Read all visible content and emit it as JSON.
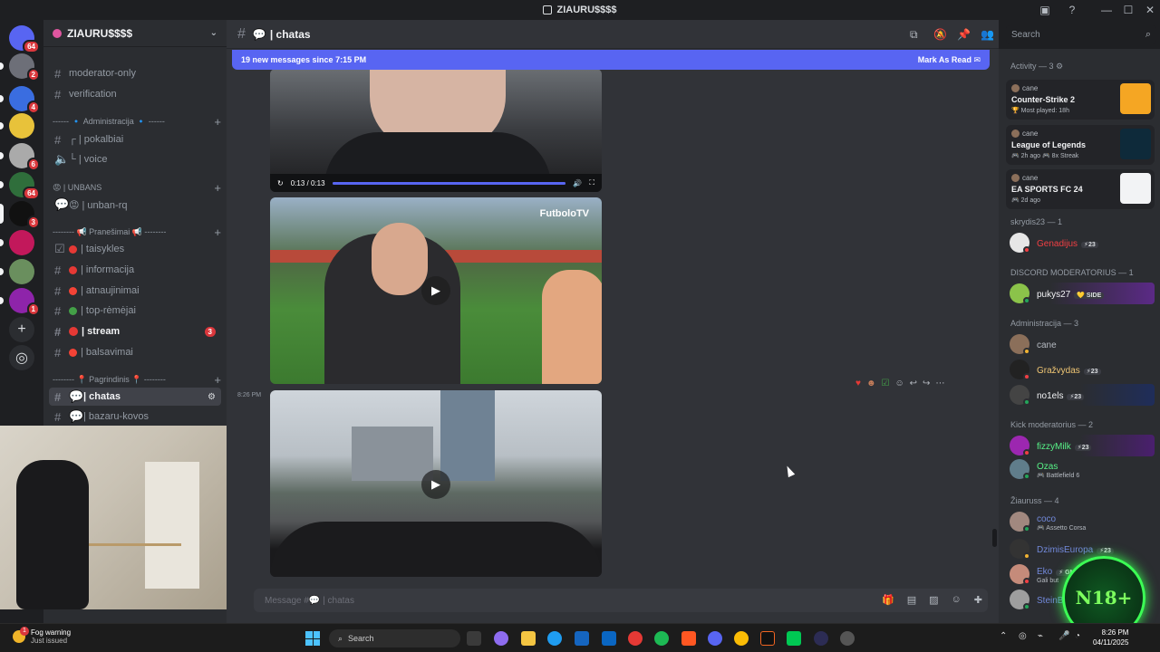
{
  "window": {
    "title": "ZIAURU$$$$"
  },
  "servers": [
    {
      "name": "discord-home",
      "badge": "64",
      "color": "#5865f2"
    },
    {
      "name": "server-2",
      "badge": "2",
      "color": "#6d6f78"
    },
    {
      "name": "server-3",
      "badge": "4",
      "color": "#3a6de0"
    },
    {
      "name": "server-4",
      "badge": "",
      "color": "#e8c23a"
    },
    {
      "name": "server-5",
      "badge": "6",
      "color": "#aaaaaa"
    },
    {
      "name": "server-6",
      "badge": "64",
      "color": "#2f6e3b"
    },
    {
      "name": "ziauru",
      "badge": "3",
      "color": "#111111"
    },
    {
      "name": "server-8",
      "badge": "",
      "color": "#c2185b"
    },
    {
      "name": "server-9",
      "badge": "",
      "color": "#6a8f5e"
    },
    {
      "name": "server-10",
      "badge": "1",
      "color": "#8e24aa"
    }
  ],
  "sidebar": {
    "server_name": "ZIAURU$$$$",
    "channels_top": [
      {
        "label": "moderator-only"
      },
      {
        "label": "verification"
      }
    ],
    "cat_admin": "------ 🔹 Administracija 🔹 ------",
    "admin_channels": [
      {
        "label": "┌ | pokalbiai"
      },
      {
        "label": "└ | voice"
      }
    ],
    "cat_unbans": "😡 | UNBANS",
    "unbans_channels": [
      {
        "label": "😡 | unban-rq"
      }
    ],
    "cat_pranesimai": "-------- 📢 Pranešimai 📢 --------",
    "pran_channels": [
      {
        "label": "| taisykles"
      },
      {
        "label": "| informacija"
      },
      {
        "label": "| atnaujinimai"
      },
      {
        "label": "| top-rėmėjai"
      },
      {
        "label": "| stream",
        "badge": "3"
      },
      {
        "label": "| balsavimai"
      }
    ],
    "cat_pagrindinis": "-------- 📍 Pagrindinis 📍 --------",
    "main_channels": [
      {
        "label": "| chatas"
      },
      {
        "label": "| bazaru-kovos"
      }
    ]
  },
  "header": {
    "channel": "| chatas"
  },
  "search": {
    "placeholder": "Search"
  },
  "chat": {
    "new_messages": "19 new messages since 7:15 PM",
    "mark_read": "Mark As Read",
    "video_time": "0:13 / 0:13",
    "video_progress": 1.0,
    "watermark": "FutboloTV",
    "timestamp": "8:26 PM"
  },
  "composer": {
    "placeholder": "Message #💬 | chatas"
  },
  "members": {
    "activity_header": "Activity — 3",
    "activities": [
      {
        "user": "cane",
        "game": "Counter-Strike 2",
        "meta": "🏆 Most played: 18h",
        "art": "#f5a623"
      },
      {
        "user": "cane",
        "game": "League of Legends",
        "meta": "🎮 2h ago  🎮 8x Streak",
        "art": "#0e2a3a"
      },
      {
        "user": "cane",
        "game": "EA SPORTS FC 24",
        "meta": "🎮 2d ago",
        "art": "#f2f3f5"
      }
    ],
    "groups": [
      {
        "header": "skrydis23 — 1",
        "items": [
          {
            "name": "Genadijus",
            "color": "#f23f43",
            "tag": "⚡23",
            "av": "#e6e6e6"
          }
        ]
      },
      {
        "header": "DISCORD MODERATORIUS — 1",
        "items": [
          {
            "name": "pukys27",
            "color": "#f2f3f5",
            "tag": "💛 SIDE",
            "av": "#8bc34a"
          }
        ]
      },
      {
        "header": "Administracija — 3",
        "items": [
          {
            "name": "cane",
            "color": "#b5bac1",
            "tag": "",
            "av": "#8b6f5a"
          },
          {
            "name": "Gražvydas",
            "color": "#f0c674",
            "tag": "⚡23",
            "av": "#222222"
          },
          {
            "name": "no1els",
            "color": "#f2f3f5",
            "tag": "⚡23",
            "av": "#444444"
          }
        ]
      },
      {
        "header": "Kick moderatorius — 2",
        "items": [
          {
            "name": "fizzyMilk",
            "color": "#57f287",
            "tag": "⚡23",
            "av": "#9c27b0"
          },
          {
            "name": "Ozas",
            "color": "#57f287",
            "tag": "",
            "sub": "🎮 Battlefield 6",
            "av": "#607d8b"
          }
        ]
      },
      {
        "header": "Žiauruss — 4",
        "items": [
          {
            "name": "coco",
            "color": "#7289da",
            "tag": "",
            "sub": "🎮 Assetto Corsa",
            "av": "#a1887f"
          },
          {
            "name": "DzimisEuropa",
            "color": "#7289da",
            "tag": "⚡23",
            "av": "#333333"
          },
          {
            "name": "Eko",
            "color": "#7289da",
            "tag": "⚡ GMDM",
            "sub": "Gali but",
            "av": "#c58b7a"
          },
          {
            "name": "SteinBagge",
            "color": "#7289da",
            "tag": "",
            "av": "#9e9e9e"
          }
        ]
      }
    ]
  },
  "overlay": {
    "badge": "N18+"
  },
  "taskbar": {
    "weather_title": "Fog warning",
    "weather_sub": "Just issued",
    "weather_badge": "1",
    "search": "Search",
    "time": "8:26 PM",
    "date": "04/11/2025"
  }
}
